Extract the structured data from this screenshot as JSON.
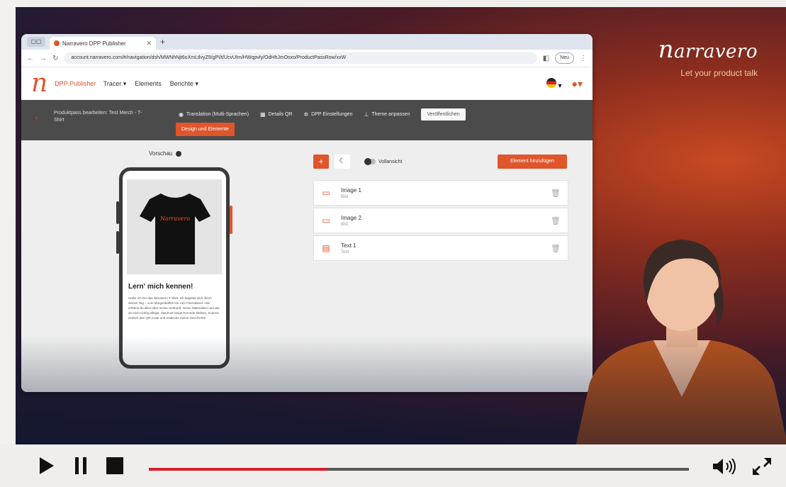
{
  "brand": {
    "logo_text": "arravero",
    "logo_initial": "n",
    "tagline": "Let your product talk"
  },
  "browser": {
    "tab_title": "Narravero DPP Publisher",
    "url": "account.narravero.com/#/navigation/dsh/MWNhNjt6oXmLtlvyZ9/gPI/t/UcvUIm/HWqpvIy/OdHhJmOsxo/ProductPassRow/xxW",
    "profile_label": "Neu"
  },
  "app": {
    "name": "DPP Publisher",
    "menu": [
      "Tracer",
      "Elements",
      "Berichte"
    ]
  },
  "toolbar": {
    "title": "Produktpass bearbeiten: Test Merch - T-Shirt",
    "items": [
      "Translation (Multi-Sprachen)",
      "Details QR",
      "DPP Einstellungen",
      "Theme anpassen"
    ],
    "publish_label": "Veröffentlichen",
    "orange_button": "Design und Elemente"
  },
  "preview": {
    "label": "Vorschau",
    "shirt_text": "Narravero",
    "heading": "Lern' mich kennen!",
    "body": "Hallo! Ich bin das Narravero T-Shirt. Ich begleite dich durch deinen Tag – vom Morgenkaffee bis zum Feierabend. Hier erfährst du alles über meine Herkunft, meine Materialien und wie du mich richtig pflegst, damit wir lange Freunde bleiben. Scanne einfach den QR-Code und entdecke meine Geschichte."
  },
  "editor": {
    "toggle_label": "Vollansicht",
    "add_button": "Element hinzufügen",
    "elements": [
      {
        "name": "Image 1",
        "sub": "Bild",
        "icon": "image-icon"
      },
      {
        "name": "Image 2",
        "sub": "Bild",
        "icon": "image-icon"
      },
      {
        "name": "Text 1",
        "sub": "Text",
        "icon": "text-icon"
      }
    ]
  },
  "player": {
    "progress": 0.33,
    "progress_color": "#d61f2b"
  },
  "colors": {
    "accent": "#e0552b"
  }
}
